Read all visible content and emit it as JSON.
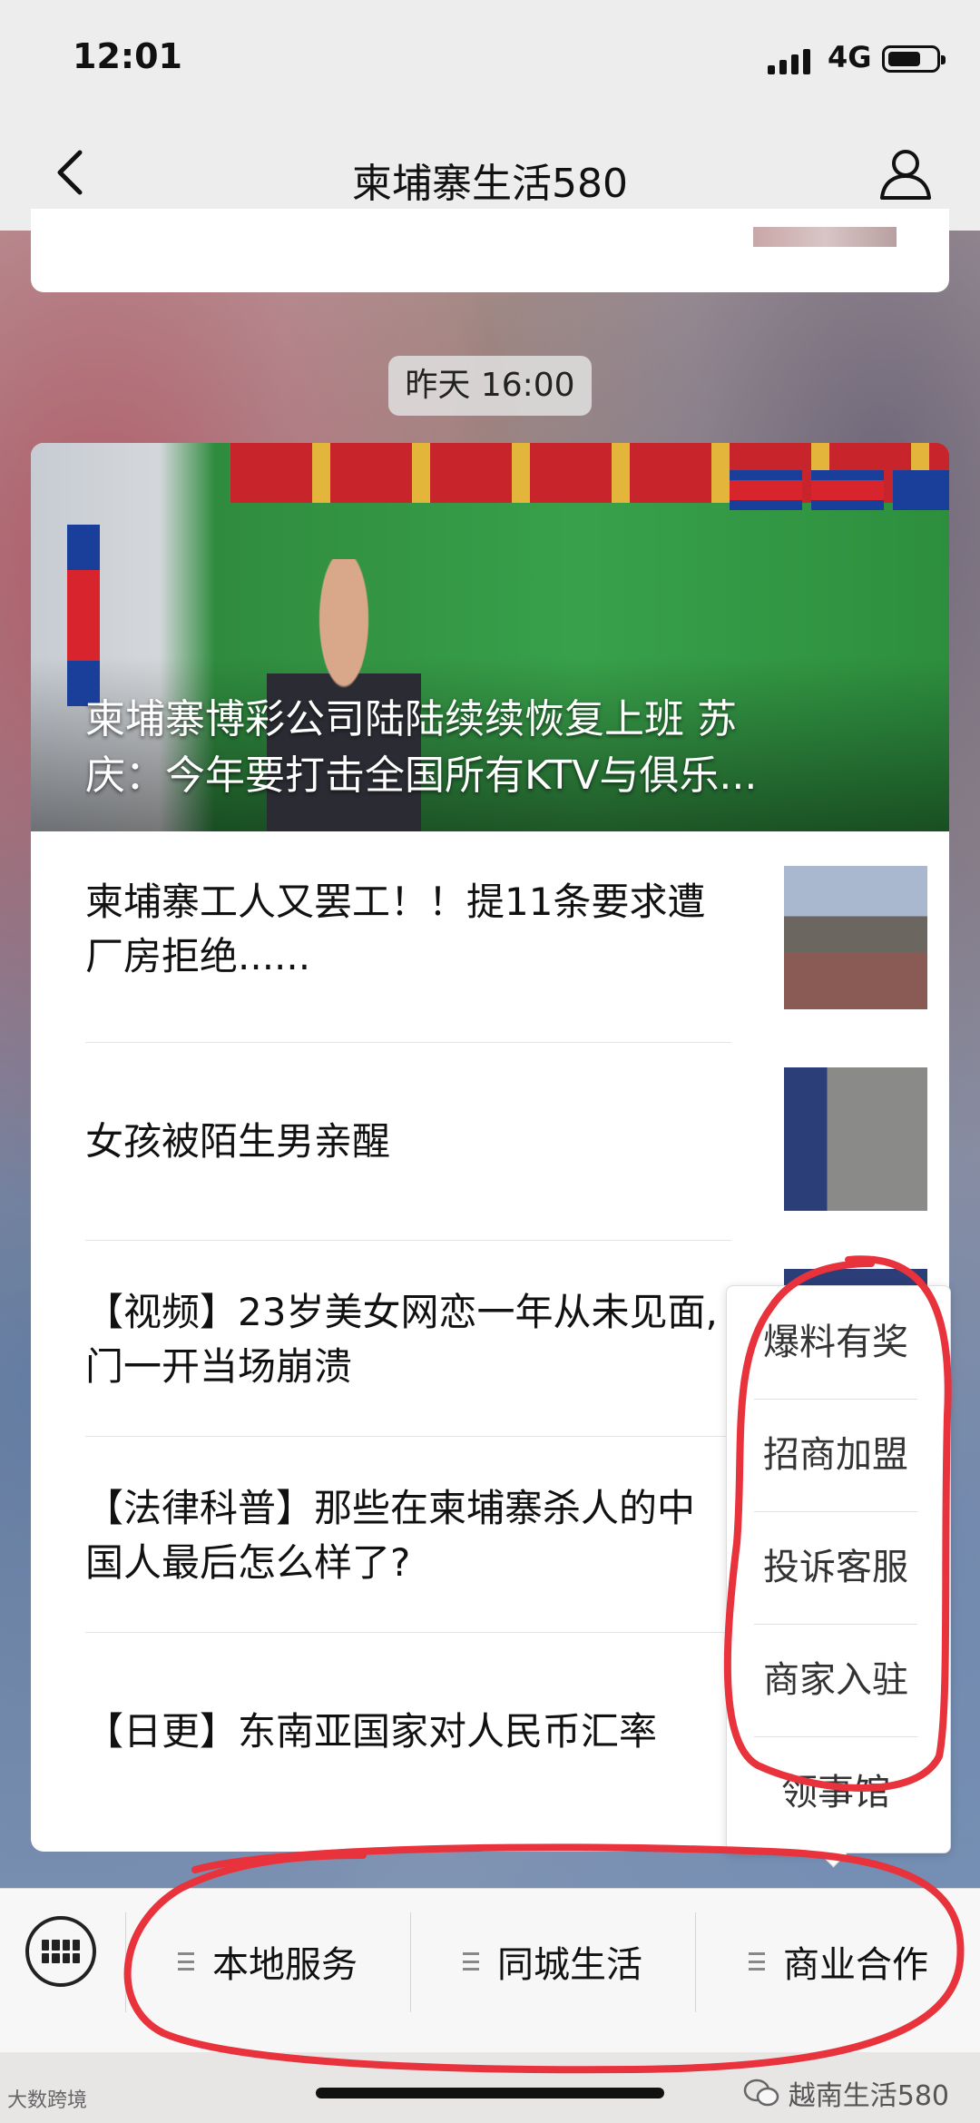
{
  "status_bar": {
    "time": "12:01",
    "network": "4G",
    "battery_percent": 70
  },
  "nav": {
    "title": "柬埔寨生活580",
    "back_icon": "chevron-left-icon",
    "profile_icon": "person-icon"
  },
  "chat": {
    "timestamp": "昨天 16:00",
    "hero": {
      "title_line1": "柬埔寨博彩公司陆陆续续恢复上班 苏",
      "title_line2": "庆：今年要打击全国所有KTV与俱乐..."
    },
    "articles": [
      {
        "title": "柬埔寨工人又罢工！！提11条要求遭厂房拒绝......"
      },
      {
        "title": "女孩被陌生男亲醒"
      },
      {
        "title": "【视频】23岁美女网恋一年从未见面, 门一开当场崩溃"
      },
      {
        "title": "【法律科普】那些在柬埔寨杀人的中国人最后怎么样了?"
      },
      {
        "title": "【日更】东南亚国家对人民币汇率"
      }
    ]
  },
  "popup_menu": {
    "items": [
      "爆料有奖",
      "招商加盟",
      "投诉客服",
      "商家入驻",
      "领事馆"
    ]
  },
  "bottom_menu": {
    "keyboard_icon": "keyboard-icon",
    "items": [
      "本地服务",
      "同城生活",
      "商业合作"
    ]
  },
  "watermark": {
    "right": "越南生活580",
    "left": "大数跨境"
  },
  "colors": {
    "annotation": "#e8323c",
    "nav_bg": "#ededed",
    "card_bg": "#ffffff"
  }
}
